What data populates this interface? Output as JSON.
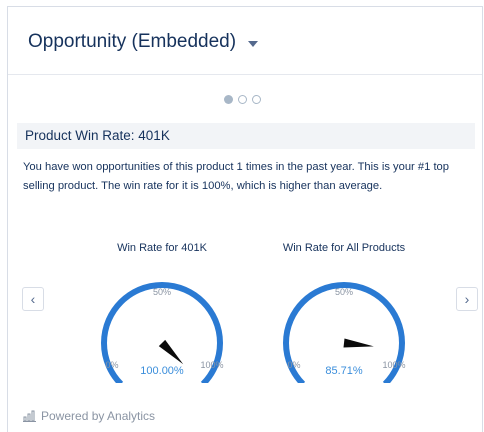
{
  "header": {
    "title": "Opportunity (Embedded)",
    "dropdown_icon": "chevron-down-icon"
  },
  "pagination": {
    "total": 3,
    "active": 1
  },
  "section": {
    "title": "Product Win Rate: 401K"
  },
  "description": "You have won opportunities of this product 1 times in the past year. This is your #1 top selling product. The win rate for it is 100%, which is higher than average.",
  "nav": {
    "prev_icon": "chevron-left-icon",
    "next_icon": "chevron-right-icon",
    "prev_glyph": "‹",
    "next_glyph": "›"
  },
  "gauges": [
    {
      "title": "Win Rate for 401K",
      "value": 100.0,
      "value_label": "100.00%",
      "min_label": "0%",
      "mid_label": "50%",
      "max_label": "100%"
    },
    {
      "title": "Win Rate for All Products",
      "value": 85.71,
      "value_label": "85.71%",
      "min_label": "0%",
      "mid_label": "50%",
      "max_label": "100%"
    }
  ],
  "colors": {
    "gauge_arc": "#2a7ad3",
    "needle": "#0b0b0b",
    "value_text": "#3b8edb"
  },
  "footer": {
    "text": "Powered by Analytics",
    "icon": "analytics-chart-icon"
  }
}
